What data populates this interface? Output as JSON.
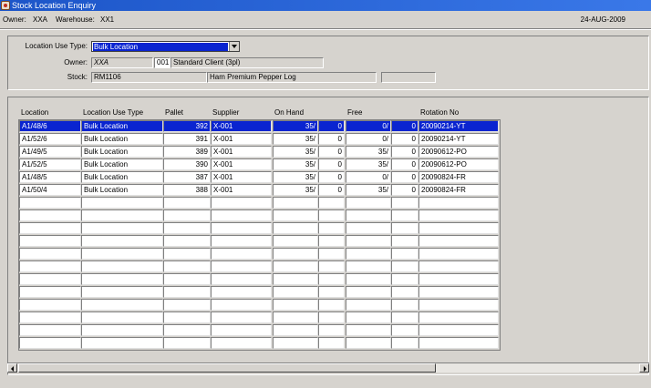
{
  "window": {
    "title": "Stock Location Enquiry",
    "icon": "oracle-forms-icon"
  },
  "info": {
    "owner_label": "Owner:",
    "owner_value": "XXA",
    "warehouse_label": "Warehouse:",
    "warehouse_value": "XX1",
    "date": "24-AUG-2009"
  },
  "form": {
    "location_use_type_label": "Location Use Type:",
    "location_use_type_value": "Bulk Location",
    "owner_label": "Owner:",
    "owner_code": "XXA",
    "client_code": "001",
    "client_name": "Standard Client (3pl)",
    "stock_label": "Stock:",
    "stock_code": "RM1106",
    "stock_description": "Ham Premium Pepper Log",
    "stock_extra": ""
  },
  "table": {
    "columns": [
      "Location",
      "Location Use Type",
      "Pallet",
      "Supplier",
      "On Hand",
      "Free",
      "Rotation No"
    ],
    "rows": [
      [
        "A1/48/6",
        "Bulk Location",
        "392",
        "X-001",
        "35/",
        "0",
        "0/",
        "0",
        "20090214-YT"
      ],
      [
        "A1/52/6",
        "Bulk Location",
        "391",
        "X-001",
        "35/",
        "0",
        "0/",
        "0",
        "20090214-YT"
      ],
      [
        "A1/49/5",
        "Bulk Location",
        "389",
        "X-001",
        "35/",
        "0",
        "35/",
        "0",
        "20090612-PO"
      ],
      [
        "A1/52/5",
        "Bulk Location",
        "390",
        "X-001",
        "35/",
        "0",
        "35/",
        "0",
        "20090612-PO"
      ],
      [
        "A1/48/5",
        "Bulk Location",
        "387",
        "X-001",
        "35/",
        "0",
        "0/",
        "0",
        "20090824-FR"
      ],
      [
        "A1/50/4",
        "Bulk Location",
        "388",
        "X-001",
        "35/",
        "0",
        "35/",
        "0",
        "20090824-FR"
      ]
    ],
    "empty_rows": 12,
    "selected_row": 0
  },
  "colors": {
    "title_bar": "#1c55c8",
    "selection": "#0a24d0",
    "background": "#d6d3ce"
  }
}
